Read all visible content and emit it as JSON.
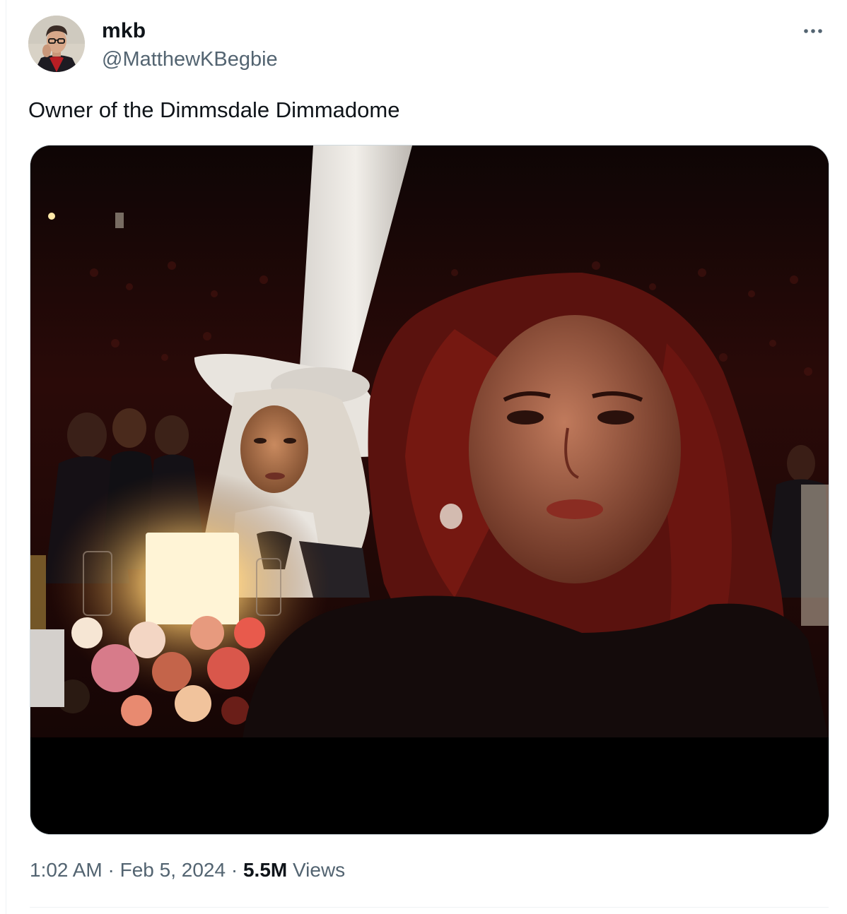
{
  "author": {
    "display_name": "mkb",
    "handle": "@MatthewKBegbie",
    "avatar_icon": "profile-photo"
  },
  "tweet": {
    "text": "Owner of the Dimmsdale Dimmadome",
    "media_alt": ""
  },
  "meta": {
    "time": "1:02 AM",
    "separator": "·",
    "date": "Feb 5, 2024",
    "views_count": "5.5M",
    "views_label": "Views"
  },
  "icons": {
    "more": "more-horizontal-icon"
  },
  "colors": {
    "primary_text": "#0f1419",
    "secondary_text": "#536471",
    "border": "#cfd9de",
    "background": "#ffffff"
  }
}
